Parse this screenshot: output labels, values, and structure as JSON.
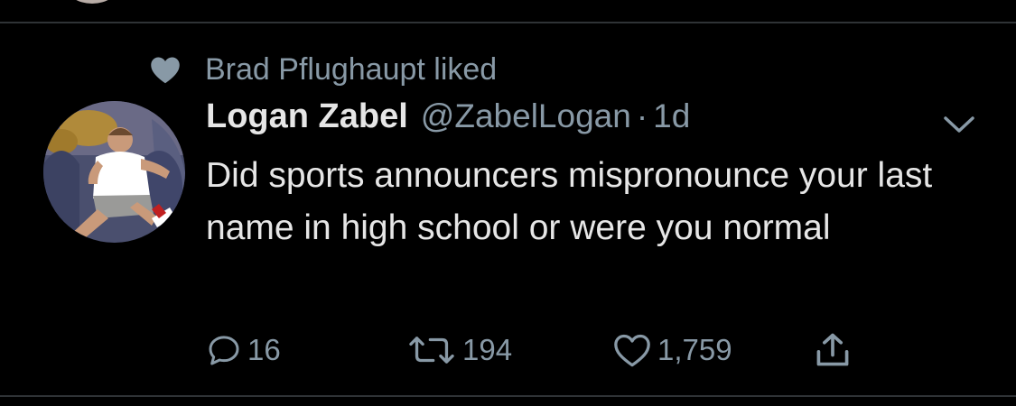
{
  "social_context": {
    "text": "Brad Pflughaupt liked",
    "icon": "heart-icon"
  },
  "tweet": {
    "author_name": "Logan Zabel",
    "handle": "@ZabelLogan",
    "separator": "·",
    "timestamp": "1d",
    "text": "Did sports announcers mispronounce your last name in high school or were you normal",
    "avatar_icon": "avatar"
  },
  "actions": {
    "reply_count": "16",
    "retweet_count": "194",
    "like_count": "1,759"
  },
  "colors": {
    "background": "#000000",
    "primary_text": "#e6e6e6",
    "secondary_text": "#8899a6",
    "divider": "#2f3336"
  }
}
